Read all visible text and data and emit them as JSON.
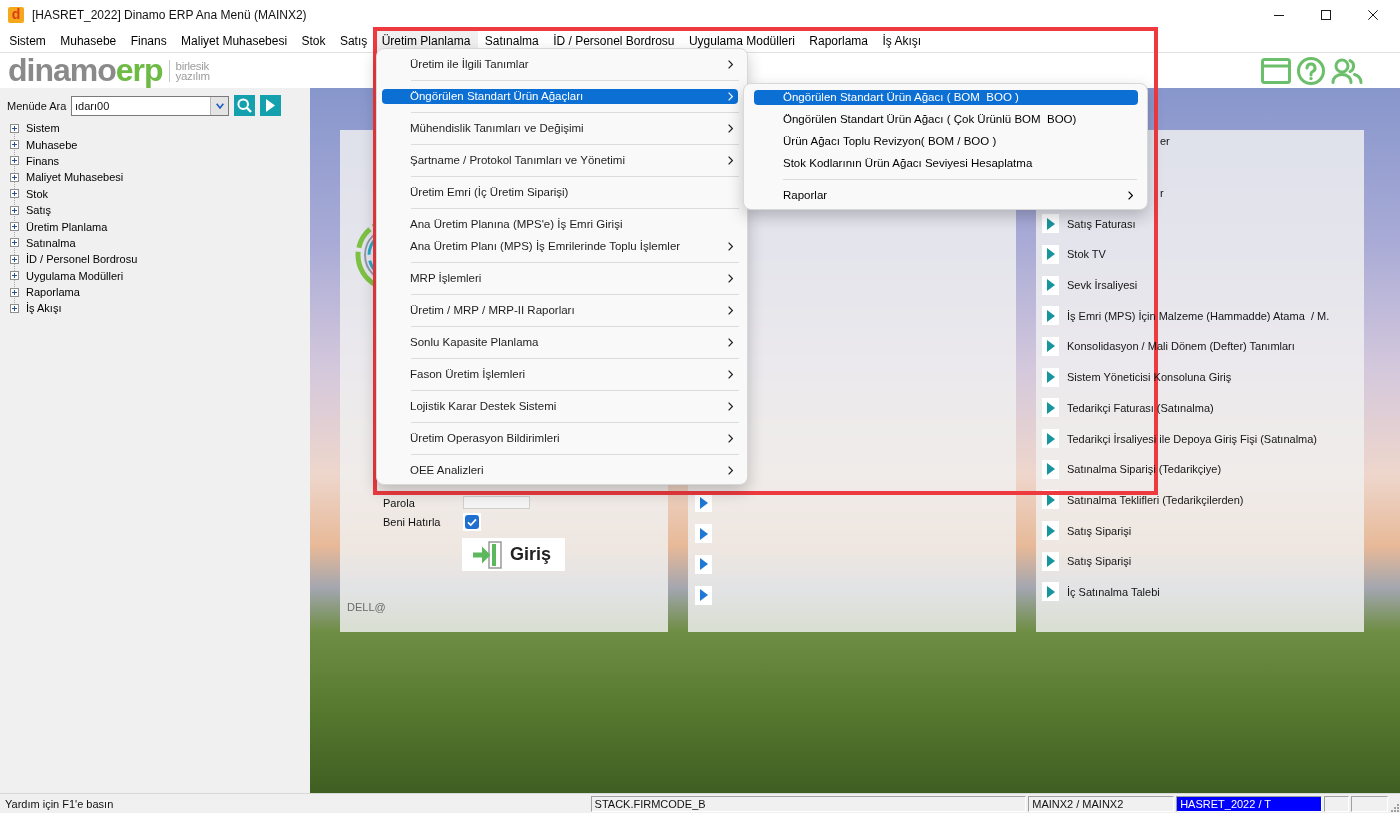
{
  "window": {
    "app_icon": "d",
    "title": "[HASRET_2022] Dinamo ERP Ana Menü (MAINX2)"
  },
  "menu_bar": [
    {
      "label": "Sistem",
      "selected": false
    },
    {
      "label": "Muhasebe",
      "selected": false
    },
    {
      "label": "Finans",
      "selected": false
    },
    {
      "label": "Maliyet Muhasebesi",
      "selected": false
    },
    {
      "label": "Stok",
      "selected": false
    },
    {
      "label": "Satış",
      "selected": false
    },
    {
      "label": "Üretim Planlama",
      "selected": true
    },
    {
      "label": "Satınalma",
      "selected": false
    },
    {
      "label": "İD / Personel Bordrosu",
      "selected": false
    },
    {
      "label": "Uygulama Modülleri",
      "selected": false
    },
    {
      "label": "Raporlama",
      "selected": false
    },
    {
      "label": "İş Akışı",
      "selected": false
    }
  ],
  "logo": {
    "name": "dinamo",
    "suffix": "erp",
    "tagline": [
      "birlesik",
      "yazılım"
    ]
  },
  "sidebar": {
    "search": {
      "label": "Menüde Ara",
      "value": "ıdarı00"
    },
    "tree": [
      {
        "label": "Sistem",
        "expanded": false
      },
      {
        "label": "Muhasebe",
        "expanded": false
      },
      {
        "label": "Finans",
        "expanded": false
      },
      {
        "label": "Maliyet Muhasebesi",
        "expanded": false
      },
      {
        "label": "Stok",
        "expanded": false
      },
      {
        "label": "Satış",
        "expanded": false
      },
      {
        "label": "Üretim Planlama",
        "expanded": false
      },
      {
        "label": "Satınalma",
        "expanded": false
      },
      {
        "label": "İD / Personel Bordrosu",
        "expanded": false
      },
      {
        "label": "Uygulama Modülleri",
        "expanded": false
      },
      {
        "label": "Raporlama",
        "expanded": false
      },
      {
        "label": "İş Akışı",
        "expanded": false
      }
    ]
  },
  "login_panel": {
    "password": {
      "label": "Parola"
    },
    "remember": {
      "label": "Beni Hatırla",
      "checked": true
    },
    "login_button": "Giriş",
    "footer": "DELL@"
  },
  "shortcut_panel": {
    "items": [
      {
        "kind": "arrow"
      },
      {
        "kind": "arrow"
      },
      {
        "kind": "arrow"
      },
      {
        "kind": "arrow"
      }
    ]
  },
  "quick_panel": {
    "items": [
      {
        "kind": "partial",
        "label": "er"
      },
      {
        "kind": "partial",
        "label": "r"
      },
      {
        "kind": "shortcut",
        "label": "Satış Faturası"
      },
      {
        "kind": "shortcut",
        "label": "Stok TV"
      },
      {
        "kind": "shortcut",
        "label": "Sevk İrsaliyesi"
      },
      {
        "kind": "shortcut",
        "label": "İş Emri (MPS) İçin Malzeme (Hammadde) Atama  / M."
      },
      {
        "kind": "shortcut",
        "label": "Konsolidasyon / Mali Dönem (Defter) Tanımları"
      },
      {
        "kind": "shortcut",
        "label": "Sistem Yöneticisi Konsoluna Giriş"
      },
      {
        "kind": "shortcut",
        "label": "Tedarikçi Faturası (Satınalma)"
      },
      {
        "kind": "shortcut",
        "label": "Tedarikçi İrsaliyesi ile Depoya Giriş Fişi (Satınalma)"
      },
      {
        "kind": "shortcut",
        "label": "Satınalma Siparişi (Tedarikçiye)"
      },
      {
        "kind": "shortcut",
        "label": "Satınalma Teklifleri (Tedarikçilerden)"
      },
      {
        "kind": "shortcut",
        "label": "Satış Siparişi"
      },
      {
        "kind": "shortcut",
        "label": "Satış Siparişi"
      },
      {
        "kind": "shortcut",
        "label": "İç Satınalma Talebi"
      }
    ]
  },
  "dropdown_menu": {
    "groups": [
      [
        {
          "label": "Üretim ile İlgili Tanımlar",
          "submenu": true,
          "selected": false
        }
      ],
      [
        {
          "label": "Öngörülen Standart Ürün Ağaçları",
          "submenu": true,
          "selected": true
        }
      ],
      [
        {
          "label": "Mühendislik Tanımları ve Değişimi",
          "submenu": true,
          "selected": false
        }
      ],
      [
        {
          "label": "Şartname / Protokol Tanımları ve Yönetimi",
          "submenu": true,
          "selected": false
        }
      ],
      [
        {
          "label": "Üretim Emri (İç Üretim Siparişi)",
          "submenu": false,
          "selected": false
        }
      ],
      [
        {
          "label": "Ana Üretim Planına (MPS'e) İş Emri Girişi",
          "submenu": false,
          "selected": false
        },
        {
          "label": "Ana Üretim Planı (MPS) İş Emrilerinde Toplu İşlemler",
          "submenu": true,
          "selected": false
        }
      ],
      [
        {
          "label": "MRP İşlemleri",
          "submenu": true,
          "selected": false
        }
      ],
      [
        {
          "label": "Üretim / MRP / MRP-II Raporları",
          "submenu": true,
          "selected": false
        }
      ],
      [
        {
          "label": "Sonlu Kapasite Planlama",
          "submenu": true,
          "selected": false
        }
      ],
      [
        {
          "label": "Fason Üretim İşlemleri",
          "submenu": true,
          "selected": false
        }
      ],
      [
        {
          "label": "Lojistik Karar Destek Sistemi",
          "submenu": true,
          "selected": false
        }
      ],
      [
        {
          "label": "Üretim Operasyon Bildirimleri",
          "submenu": true,
          "selected": false
        }
      ],
      [
        {
          "label": "OEE Analizleri",
          "submenu": true,
          "selected": false
        }
      ]
    ]
  },
  "submenu": {
    "groups": [
      [
        {
          "label": "Öngörülen Standart Ürün Ağacı ( BOM  BOO )",
          "submenu": false,
          "selected": true
        },
        {
          "label": "Öngörülen Standart Ürün Ağacı ( Çok Ürünlü BOM  BOO)",
          "submenu": false,
          "selected": false
        },
        {
          "label": "Ürün Ağacı Toplu Revizyon( BOM / BOO )",
          "submenu": false,
          "selected": false
        },
        {
          "label": "Stok Kodlarının Ürün Ağacı Seviyesi Hesaplatma",
          "submenu": false,
          "selected": false
        }
      ],
      [
        {
          "label": "Raporlar",
          "submenu": true,
          "selected": false
        }
      ]
    ]
  },
  "status_bar": {
    "hint": "Yardım için F1'e basın",
    "panels": [
      {
        "text": "STACK.FIRMCODE_B",
        "highlighted": false
      },
      {
        "text": "MAINX2 / MAINX2",
        "highlighted": false
      },
      {
        "text": "HASRET_2022 / T",
        "highlighted": true
      },
      {
        "highlighted": false
      },
      {
        "highlighted": false
      }
    ]
  }
}
